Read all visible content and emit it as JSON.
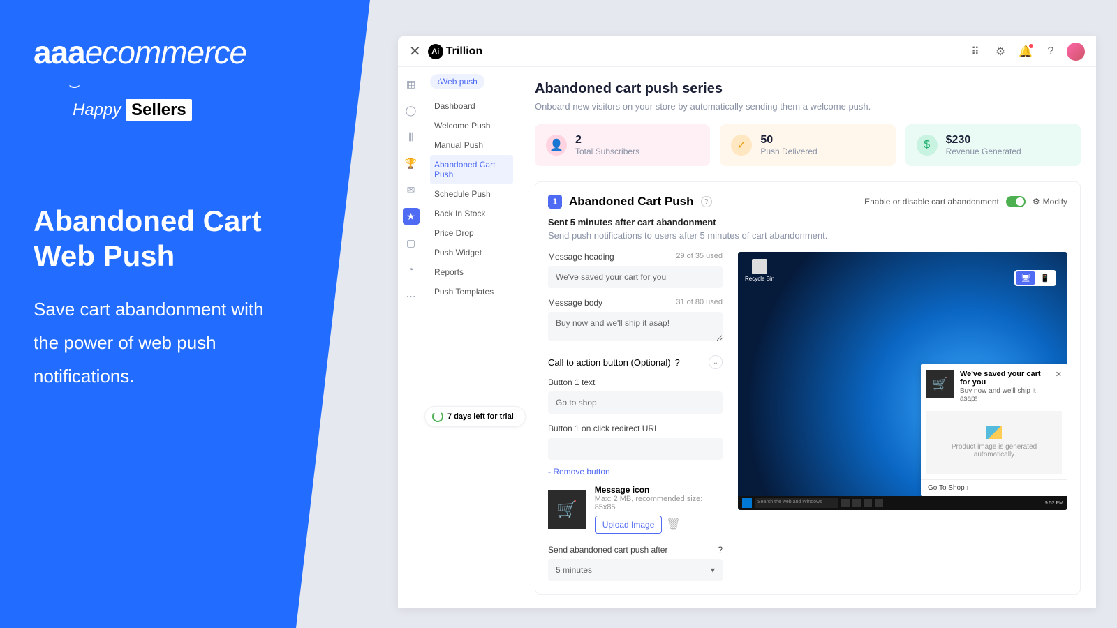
{
  "promo": {
    "logo_aaa": "aaa",
    "logo_ec": "ecommerce",
    "happy": "Happy",
    "sellers": "Sellers",
    "title_l1": "Abandoned Cart",
    "title_l2": "Web Push",
    "desc": "Save cart abandonment with the power of web push notifications."
  },
  "brand": "Trillion",
  "brand_prefix": "Ai",
  "subnav_pill": "Web push",
  "subnav_items": [
    "Dashboard",
    "Welcome Push",
    "Manual Push",
    "Abandoned Cart Push",
    "Schedule Push",
    "Back In Stock",
    "Price Drop",
    "Push Widget",
    "Reports",
    "Push Templates"
  ],
  "subnav_active_index": 3,
  "trial_text": "7 days left for trial",
  "page": {
    "title": "Abandoned cart push series",
    "subtitle": "Onboard new visitors on your store by automatically sending them a welcome push."
  },
  "stats": [
    {
      "value": "2",
      "label": "Total Subscribers"
    },
    {
      "value": "50",
      "label": "Push Delivered"
    },
    {
      "value": "$230",
      "label": "Revenue Generated"
    }
  ],
  "step": {
    "badge": "1",
    "title": "Abandoned Cart Push",
    "toggle_label": "Enable or disable cart abandonment",
    "modify": "Modify",
    "timing": "Sent 5 minutes after cart abandonment",
    "desc": "Send push notifications to users after 5 minutes of cart abandonment."
  },
  "form": {
    "heading_label": "Message heading",
    "heading_used": "29 of 35 used",
    "heading_value": "We've saved your cart for you",
    "body_label": "Message body",
    "body_used": "31 of 80 used",
    "body_value": "Buy now and we'll ship it asap!",
    "cta_section": "Call to action button (Optional)",
    "btn1_label": "Button 1 text",
    "btn1_value": "Go to shop",
    "btn1_url_label": "Button 1 on click redirect URL",
    "btn1_url_value": "",
    "remove": "- Remove button",
    "icon_label": "Message icon",
    "icon_meta": "Max: 2 MB, recommended size: 85x85",
    "upload": "Upload Image",
    "after_label": "Send abandoned cart push after",
    "after_value": "5 minutes"
  },
  "preview": {
    "recycle": "Recycle Bin",
    "search_placeholder": "Search the web and Windows",
    "time": "9:52 PM",
    "notif_title": "We've saved your cart for you",
    "notif_body": "Buy now and we'll ship it asap!",
    "notif_img_text": "Product image is generated automatically",
    "notif_cta": "Go To Shop ›"
  }
}
